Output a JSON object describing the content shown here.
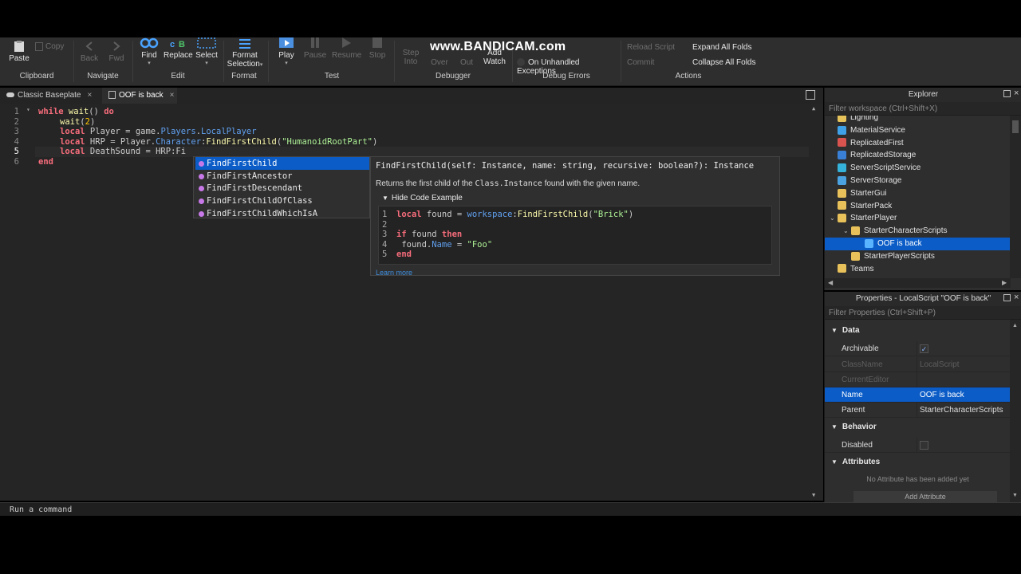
{
  "watermark": "www.BANDICAM.com",
  "ribbon": {
    "clipboard": {
      "paste": "Paste",
      "copy": "Copy",
      "group": "Clipboard"
    },
    "navigate": {
      "back": "Back",
      "fwd": "Fwd",
      "group": "Navigate"
    },
    "edit": {
      "find": "Find",
      "replace": "Replace",
      "select": "Select",
      "group": "Edit"
    },
    "format": {
      "format_selection_1": "Format",
      "format_selection_2": "Selection",
      "group": "Format"
    },
    "test": {
      "play": "Play",
      "pause": "Pause",
      "resume": "Resume",
      "stop": "Stop",
      "group": "Test"
    },
    "debugger": {
      "step_into_1": "Step",
      "step_into_2": "Into",
      "step_over_2": "Over",
      "step_out_2": "Out",
      "add_watch_1": "Add",
      "add_watch_2": "Watch",
      "group": "Debugger"
    },
    "debug_errors": {
      "on_unhandled": "On Unhandled Exceptions",
      "group": "Debug Errors"
    },
    "actions": {
      "reload_script": "Reload Script",
      "commit": "Commit",
      "expand_all": "Expand All Folds",
      "collapse_all": "Collapse All Folds",
      "group": "Actions"
    }
  },
  "tabs": [
    {
      "label": "Classic Baseplate",
      "close": "×"
    },
    {
      "label": "OOF is back",
      "close": "×"
    }
  ],
  "editor": {
    "line_numbers": [
      "1",
      "2",
      "3",
      "4",
      "5",
      "6"
    ],
    "lines": {
      "l1_kw1": "while",
      "l1_fn": " wait",
      "l1_rest": "() ",
      "l1_kw2": "do",
      "l2_fn": "wait",
      "l2_open": "(",
      "l2_num": "2",
      "l2_close": ")",
      "l3_kw": "local",
      "l3_a": " Player = game.",
      "l3_p1": "Players",
      "l3_b": ".",
      "l3_p2": "LocalPlayer",
      "l4_kw": "local",
      "l4_a": " HRP = Player.",
      "l4_p1": "Character",
      "l4_b": ":",
      "l4_fn": "FindFirstChild",
      "l4_c": "(",
      "l4_str": "\"HumanoidRootPart\"",
      "l4_d": ")",
      "l5_kw": "local",
      "l5_a": " DeathSound = HRP:Fi",
      "l6_kw": "end"
    }
  },
  "autocomplete": {
    "items": [
      "FindFirstChild",
      "FindFirstAncestor",
      "FindFirstDescendant",
      "FindFirstChildOfClass",
      "FindFirstChildWhichIsA"
    ]
  },
  "doc": {
    "signature": "FindFirstChild(self: Instance, name: string, recursive: boolean?): Instance",
    "desc_a": "Returns the first child of the ",
    "desc_mono": "Class.Instance",
    "desc_b": " found with the given name.",
    "hide_example": "Hide Code Example",
    "example_line_numbers": [
      "1",
      "2",
      "3",
      "4",
      "5"
    ],
    "ex1_kw": "local",
    "ex1_a": " found = ",
    "ex1_p": "workspace",
    "ex1_b": ":",
    "ex1_fn": "FindFirstChild",
    "ex1_c": "(",
    "ex1_str": "\"Brick\"",
    "ex1_d": ")",
    "ex3_kw1": "if",
    "ex3_a": " found ",
    "ex3_kw2": "then",
    "ex4_a": " found.",
    "ex4_p": "Name",
    "ex4_b": " = ",
    "ex4_str": "\"Foo\"",
    "ex5_kw": "end",
    "learn_more": "Learn more"
  },
  "command_bar": {
    "placeholder": "Run a command"
  },
  "explorer": {
    "title": "Explorer",
    "filter": "Filter workspace (Ctrl+Shift+X)",
    "items": [
      {
        "label": "Lighting",
        "indent": 0,
        "icon": "#e5c35a"
      },
      {
        "label": "MaterialService",
        "indent": 0,
        "icon": "#3fa1e8"
      },
      {
        "label": "ReplicatedFirst",
        "indent": 0,
        "icon": "#d9534f"
      },
      {
        "label": "ReplicatedStorage",
        "indent": 0,
        "icon": "#3a7fd6"
      },
      {
        "label": "ServerScriptService",
        "indent": 0,
        "icon": "#35b2d9"
      },
      {
        "label": "ServerStorage",
        "indent": 0,
        "icon": "#4aa3e0"
      },
      {
        "label": "StarterGui",
        "indent": 0,
        "icon": "#e8c15a"
      },
      {
        "label": "StarterPack",
        "indent": 0,
        "icon": "#e8c15a"
      },
      {
        "label": "StarterPlayer",
        "indent": 0,
        "icon": "#e8c15a",
        "expanded": true
      },
      {
        "label": "StarterCharacterScripts",
        "indent": 1,
        "icon": "#e8c15a",
        "expanded": true
      },
      {
        "label": "OOF is back",
        "indent": 2,
        "icon": "#5ab3ff",
        "selected": true
      },
      {
        "label": "StarterPlayerScripts",
        "indent": 1,
        "icon": "#e8c15a"
      },
      {
        "label": "Teams",
        "indent": 0,
        "icon": "#e8c15a"
      }
    ]
  },
  "properties": {
    "title": "Properties - LocalScript \"OOF is back\"",
    "filter": "Filter Properties (Ctrl+Shift+P)",
    "sections": {
      "data": "Data",
      "behavior": "Behavior",
      "attributes": "Attributes"
    },
    "rows": {
      "archivable": {
        "k": "Archivable",
        "v": "✓"
      },
      "classname": {
        "k": "ClassName",
        "v": "LocalScript"
      },
      "currenteditor": {
        "k": "CurrentEditor",
        "v": ""
      },
      "name": {
        "k": "Name",
        "v": "OOF is back"
      },
      "parent": {
        "k": "Parent",
        "v": "StarterCharacterScripts"
      },
      "disabled": {
        "k": "Disabled",
        "v": ""
      }
    },
    "no_attribute": "No Attribute has been added yet",
    "add_attribute": "Add Attribute"
  }
}
